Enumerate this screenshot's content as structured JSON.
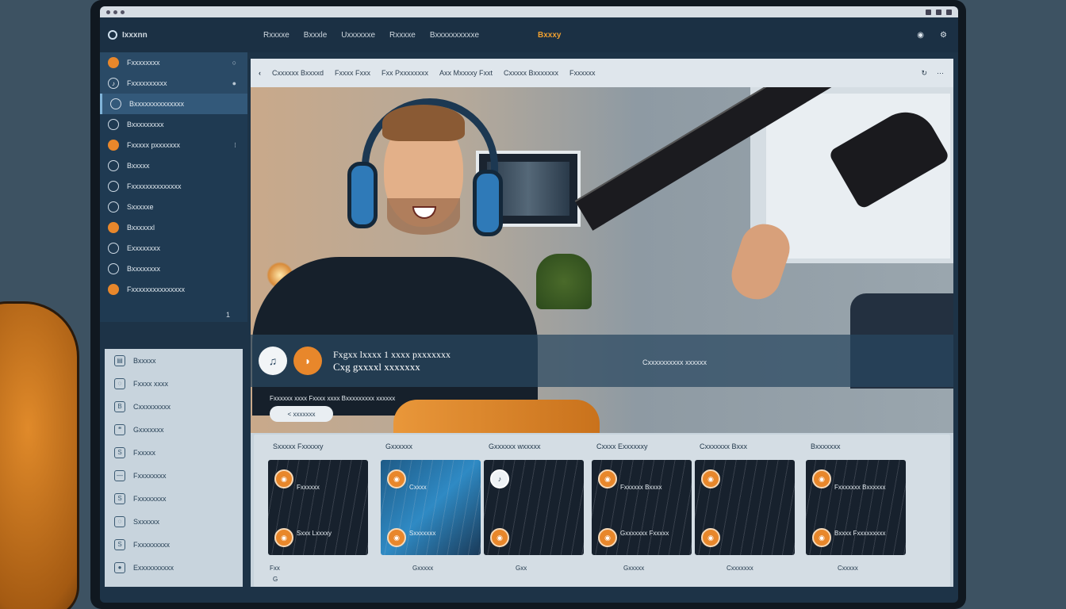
{
  "os_bar": {
    "title": "",
    "icons": [
      "window-dot-icon",
      "window-dot-icon",
      "window-dot-icon"
    ]
  },
  "header": {
    "brand": "Ixxxnn",
    "nav": [
      "Rxxxxe",
      "Bxxxle",
      "Uxxxxxxe",
      "Rxxxxe",
      "Bxxxxxxxxxxe"
    ],
    "center_title": "Bxxxy",
    "icons": [
      "user-icon",
      "settings-icon"
    ]
  },
  "sidebar": {
    "items": [
      {
        "label": "Fxxxxxxxx",
        "icon": "orange-dot",
        "trail": "○",
        "style": "hl"
      },
      {
        "label": "Fxxxxxxxxxx",
        "icon": "music-note",
        "trail": "●",
        "style": "hl"
      },
      {
        "label": "Bxxxxxxxxxxxxxx",
        "icon": "list",
        "trail": "",
        "style": "hl2"
      },
      {
        "label": "Bxxxxxxxxx",
        "icon": "ring",
        "trail": "",
        "style": ""
      },
      {
        "label": "Fxxxxx pxxxxxxx",
        "icon": "orange-dot",
        "trail": "⁝",
        "style": ""
      },
      {
        "label": "Bxxxxx",
        "icon": "ring",
        "trail": "",
        "style": ""
      },
      {
        "label": "Fxxxxxxxxxxxxxx",
        "icon": "ring",
        "trail": "",
        "style": ""
      },
      {
        "label": "Sxxxxxe",
        "icon": "ring",
        "trail": "",
        "style": ""
      },
      {
        "label": "Bxxxxxxl",
        "icon": "orange-dot",
        "trail": "",
        "style": ""
      },
      {
        "label": "Exxxxxxxx",
        "icon": "ring",
        "trail": "",
        "style": ""
      },
      {
        "label": "Bxxxxxxxx",
        "icon": "ring",
        "trail": "",
        "style": ""
      },
      {
        "label": "Fxxxxxxxxxxxxxxx",
        "icon": "orange-dot",
        "trail": "",
        "style": ""
      }
    ],
    "counter": "1"
  },
  "sidebar2": {
    "items": [
      {
        "label": "Bxxxxx",
        "icon": "doc-icon"
      },
      {
        "label": "Fxxxx xxxx",
        "icon": "circle-icon"
      },
      {
        "label": "Cxxxxxxxxx",
        "icon": "book-icon"
      },
      {
        "label": "Gxxxxxxx",
        "icon": "chat-icon"
      },
      {
        "label": "Fxxxxx",
        "icon": "tag-icon"
      },
      {
        "label": "Fxxxxxxxx",
        "icon": "bar-icon"
      },
      {
        "label": "Fxxxxxxxx",
        "icon": "tag-icon"
      },
      {
        "label": "Sxxxxxx",
        "icon": "circle-icon"
      },
      {
        "label": "Fxxxxxxxxx",
        "icon": "list-icon"
      },
      {
        "label": "Exxxxxxxxxx",
        "icon": "dot-icon"
      }
    ]
  },
  "breadcrumb": {
    "back": "‹",
    "items": [
      "Cxxxxxx Bxxxxd",
      "Fxxxx Fxxx",
      "Fxx Pxxxxxxxx",
      "Axx Mxxxxy Fxxt",
      "Cxxxxx Bxxxxxxx",
      "Fxxxxxx"
    ],
    "tools": [
      "↻",
      "⋯"
    ]
  },
  "hero": {
    "overlay_line1": "Fxgxx lxxxx 1 xxxx pxxxxxxx",
    "overlay_line2": "Cxg gxxxxl xxxxxxx",
    "overlay_right": "Cxxxxxxxxxx xxxxxx",
    "meta": "Fxxxxxx xxxx Fxxxx xxxx Bxxxxxxxxx xxxxxx",
    "pill": "< xxxxxxx"
  },
  "lessons": [
    {
      "title": "Sxxxxx Fxxxxxy",
      "t1": "Fxxxxxx",
      "t2": "Sxxx Lxxxxy",
      "footer": "Fxx",
      "footer2": "G",
      "style": "dark"
    },
    {
      "title": "Gxxxxxx",
      "t1": "Cxxxx",
      "t2": "Sxxxxxxx",
      "footer": "Gxxxxx",
      "footer2": "",
      "style": "blue"
    },
    {
      "title": "Gxxxxxx wxxxxx",
      "t1": "",
      "t2": "",
      "footer": "Gxx",
      "footer2": "",
      "style": "dark",
      "b1w": true
    },
    {
      "title": "Cxxxx Exxxxxxy",
      "t1": "Fxxxxxx Bxxxx",
      "t2": "Gxxxxxxx Fxxxxx",
      "footer": "Gxxxxx",
      "footer2": "",
      "style": "dark"
    },
    {
      "title": "Cxxxxxxx Bxxx",
      "t1": "",
      "t2": "",
      "footer": "Cxxxxxxx",
      "footer2": "",
      "style": "dark"
    },
    {
      "title": "Bxxxxxxx",
      "t1": "Fxxxxxxx Bxxxxxx",
      "t2": "Bxxxx Fxxxxxxxxx",
      "footer": "Cxxxxx",
      "footer2": "",
      "style": "dark"
    }
  ],
  "lessons_footer_extra": "Cxxxxxxxxx",
  "colors": {
    "accent": "#e8872b",
    "sidebar": "#1f3a52",
    "panel": "#b9c8d2"
  }
}
